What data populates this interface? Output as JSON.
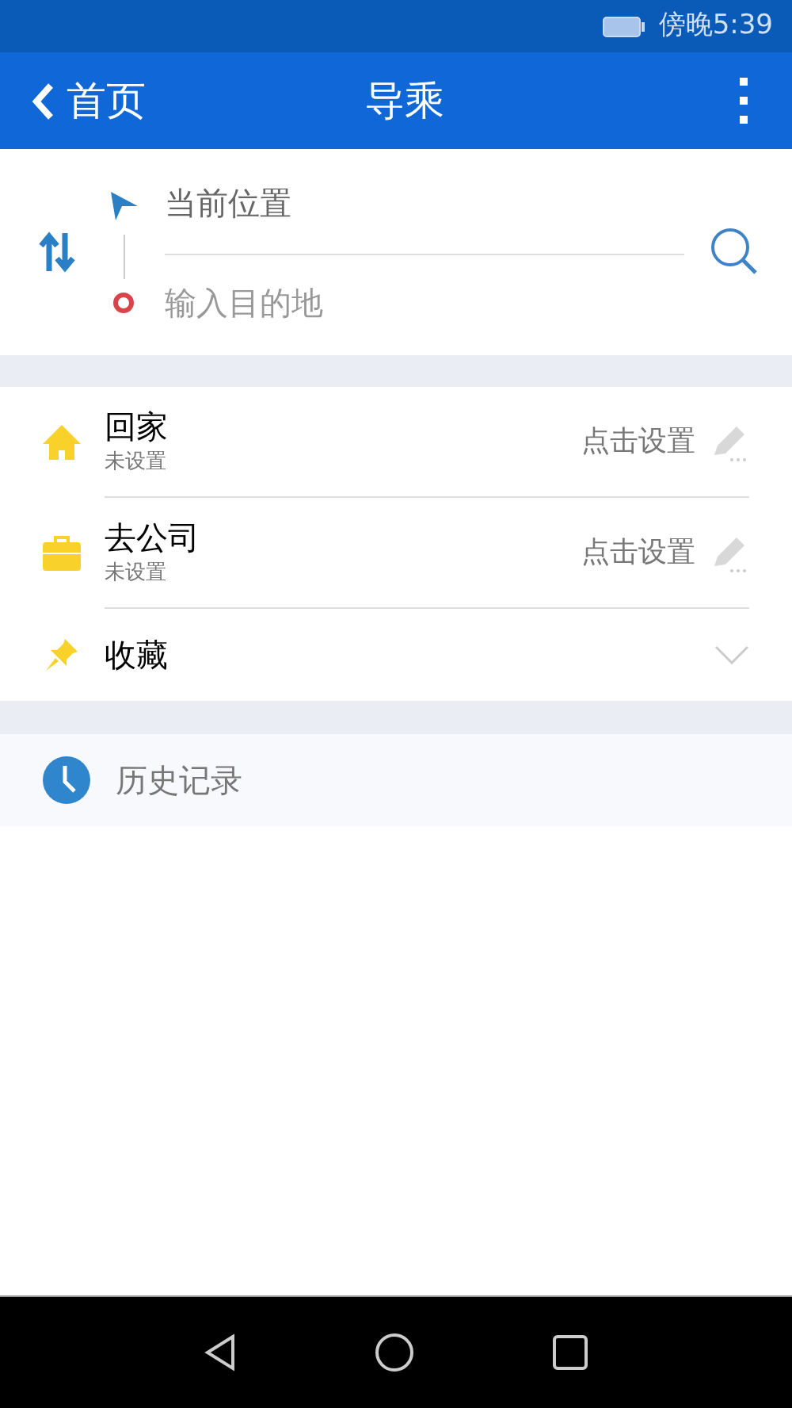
{
  "status_bar": {
    "time": "傍晚5:39"
  },
  "app_bar": {
    "back_label": "首页",
    "title": "导乘"
  },
  "route": {
    "origin": {
      "value": "当前位置"
    },
    "destination": {
      "placeholder": "输入目的地"
    }
  },
  "shortcuts": [
    {
      "kind": "home",
      "title": "回家",
      "subtitle": "未设置",
      "action": "点击设置"
    },
    {
      "kind": "work",
      "title": "去公司",
      "subtitle": "未设置",
      "action": "点击设置"
    },
    {
      "kind": "favorites",
      "title": "收藏",
      "expanded": false
    }
  ],
  "history": {
    "title": "历史记录"
  }
}
